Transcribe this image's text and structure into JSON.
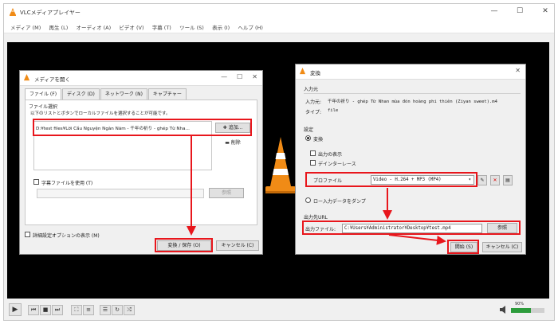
{
  "window": {
    "title": "VLCメディアプレイヤー",
    "minimize": "—",
    "maximize": "☐",
    "close": "✕"
  },
  "menu": [
    "メディア (M)",
    "再生 (L)",
    "オーディオ (A)",
    "ビデオ (V)",
    "字幕 (T)",
    "ツール (S)",
    "表示 (I)",
    "ヘルプ (H)"
  ],
  "open_dialog": {
    "title": "メディアを開く",
    "tabs": [
      "ファイル (F)",
      "ディスク (D)",
      "ネットワーク (N)",
      "キャプチャー"
    ],
    "file_group_label": "ファイル選択",
    "instruction": "以下のリストとボタンでローカルファイルを選択することが可能です。",
    "file_entry": "D:¥test files¥Lời Cầu Nguyện Ngàn Năm - 千年の祈り - ghép Từ Nha...",
    "add_button": "追加...",
    "remove_button": "削除",
    "subtitle_checkbox": "字幕ファイルを使用 (T)",
    "browse_button": "参照",
    "advanced_checkbox": "詳細設定オプションの表示 (M)",
    "convert_button": "変換 / 保存 (O)",
    "cancel_button": "キャンセル (C)"
  },
  "convert_dialog": {
    "title": "変換",
    "source_group": "入力元",
    "source_label": "入力元:",
    "source_value": "千年の祈り - ghép Từ Nhan mùa đón hoàng phi thiên (Ziyan sweet).m4",
    "type_label": "タイプ:",
    "type_value": "file",
    "settings_group": "設定",
    "convert_radio": "変換",
    "show_output_checkbox": "出力の表示",
    "deinterlace_checkbox": "デインターレース",
    "profile_label": "プロファイル",
    "profile_value": "Video - H.264 + MP3 (MP4)",
    "dump_radio": "ロー入力データをダンプ",
    "dest_group": "出力先URL",
    "dest_label": "出力ファイル:",
    "dest_value": "C:¥Users¥Administrator¥Desktop¥test.mp4",
    "browse_button": "参照",
    "start_button": "開始 (S)",
    "cancel_button": "キャンセル (C)"
  },
  "volume": {
    "percent": "90%",
    "level": 0.6
  },
  "colors": {
    "highlight": "#e8161c",
    "video_bg": "#000000",
    "accent": "#2d9c3c",
    "vlc_orange": "#f08b16"
  },
  "icons": [
    "vlc-cone-icon",
    "play-icon",
    "prev-icon",
    "stop-icon",
    "next-icon",
    "fullscreen-icon",
    "extended-settings-icon",
    "playlist-icon",
    "loop-icon",
    "random-icon",
    "volume-icon",
    "add-icon",
    "remove-icon",
    "edit-profile-icon",
    "delete-profile-icon",
    "new-profile-icon"
  ]
}
